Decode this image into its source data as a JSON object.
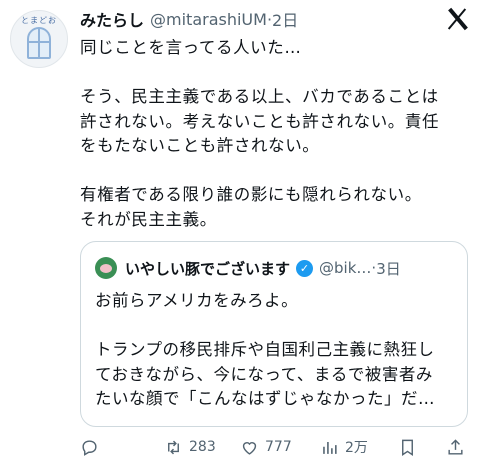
{
  "tweet": {
    "author_name": "みたらし",
    "handle": "@mitarashiUM",
    "time": "2日",
    "avatar_tag": "とまどお",
    "lines": [
      "同じことを言ってる人いた…",
      "",
      "そう、民主主義である以上、バカであることは",
      "許されない。考えないことも許されない。責任",
      "をもたないことも許されない。",
      "",
      "有権者である限り誰の影にも隠れられない。",
      "それが民主主義。"
    ]
  },
  "quote": {
    "author_name": "いやしい豚でございます",
    "handle": "@bik…",
    "time": "3日",
    "lines": [
      "お前らアメリカをみろよ。",
      "",
      "トランプの移民排斥や自国利己主義に熱狂し",
      "ておきながら、今になって、まるで被害者み",
      "たいな顔で「こんなはずじゃなかった」だ…"
    ]
  },
  "actions": {
    "reply_icon": "reply-icon",
    "retweet_count": "283",
    "like_count": "777",
    "views_count": "2万",
    "share_icon": "share-icon"
  },
  "colors": {
    "verified": "#1d9bf0",
    "secondary_text": "#536471",
    "border": "#cfd9de"
  }
}
